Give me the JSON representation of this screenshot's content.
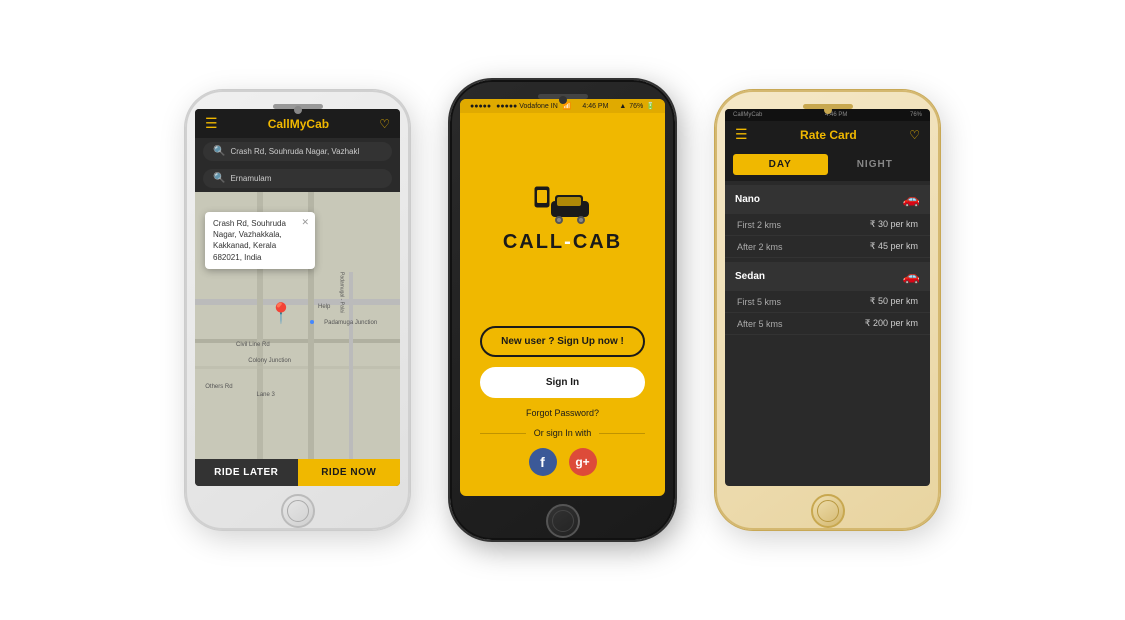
{
  "phone1": {
    "topbar": {
      "title": "CallMyCab"
    },
    "search1": "Crash Rd, Souhruda Nagar, Vazhakl",
    "search2": "Ernamulam",
    "popup": {
      "text": "Crash Rd, Souhruda Nagar, Vazhakkala, Kakkanad, Kerala 682021, India"
    },
    "buttons": {
      "ride_later": "RIDE LATER",
      "ride_now": "RIDE NOW"
    }
  },
  "phone2": {
    "status": {
      "left": "●●●●● Vodafone IN",
      "wifi": "WiFi",
      "time": "4:46 PM",
      "signal": "76%"
    },
    "logo": "CALL-CAB",
    "buttons": {
      "signup": "New user ? Sign Up now !",
      "signin": "Sign In",
      "forgot": "Forgot Password?"
    },
    "divider": "Or sign In with"
  },
  "phone3": {
    "topbar": {
      "title": "Rate Card"
    },
    "tabs": {
      "day": "DAY",
      "night": "NIGHT"
    },
    "sections": [
      {
        "name": "Nano",
        "rows": [
          {
            "label": "First 2 kms",
            "value": "₹ 30 per km"
          },
          {
            "label": "After 2 kms",
            "value": "₹ 45 per km"
          }
        ]
      },
      {
        "name": "Sedan",
        "rows": [
          {
            "label": "First 5 kms",
            "value": "₹ 50 per km"
          },
          {
            "label": "After 5 kms",
            "value": "₹ 200 per km"
          }
        ]
      }
    ]
  }
}
